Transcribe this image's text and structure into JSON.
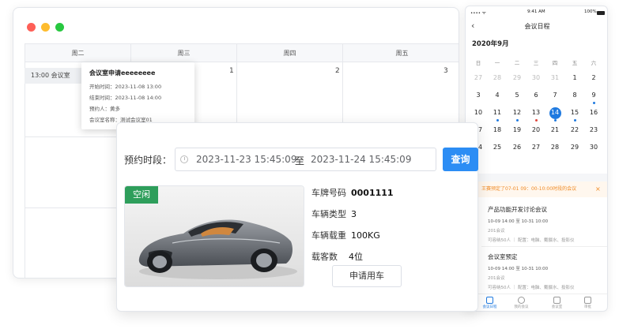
{
  "calendar": {
    "weekdays": [
      "周二",
      "周三",
      "周四",
      "周五"
    ],
    "day_numbers": [
      "1",
      "2",
      "3"
    ],
    "event_label": "13:00  会议室",
    "tooltip": {
      "title": "会议室申请eeeeeeee",
      "start": "开始时间：2023-11-08 13:00",
      "end": "结束时间：2023-11-08 14:00",
      "booker": "预约人：黄多",
      "room": "会议室名称：测试会议室01"
    },
    "window_dot_colors": [
      "#fe5f57",
      "#febc2e",
      "#28c840"
    ]
  },
  "phone": {
    "status_time": "9:41 AM",
    "battery": "100%",
    "back_icon": "chevron-left-icon",
    "title": "会议日程",
    "month": "2020年9月",
    "weekdays": [
      "日",
      "一",
      "二",
      "三",
      "四",
      "五",
      "六"
    ],
    "days": [
      [
        "27",
        "28",
        "29",
        "30",
        "31",
        "1",
        "2"
      ],
      [
        "3",
        "4",
        "5",
        "6",
        "7",
        "8",
        "9"
      ],
      [
        "10",
        "11",
        "12",
        "13",
        "14",
        "15",
        "16"
      ],
      [
        "17",
        "18",
        "19",
        "20",
        "21",
        "22",
        "23"
      ],
      [
        "24",
        "25",
        "26",
        "27",
        "28",
        "29",
        "30"
      ]
    ],
    "selected_day": "14",
    "notice": "王赛预定了07-01 09：00-10:00时段的会议",
    "notice_close": "×",
    "meetings": [
      {
        "title": "产品功能开发讨论会议",
        "time": "10-09  14:00 至 10-31 10:00",
        "room": "201会议",
        "meta": "可容纳50人 ｜ 配置：电脑、戴摄水、投影仪"
      },
      {
        "title": "会议室预定",
        "time": "10-09  14:00 至 10-31 10:00",
        "room": "201会议",
        "meta": "可容纳50人 ｜ 配置：电脑、戴摄水、投影仪"
      }
    ],
    "tabs": [
      "会议日程",
      "我的会议",
      "会议室",
      "审批"
    ],
    "accent_color": "#1f7ae0"
  },
  "booking": {
    "time_label": "预约时段：",
    "start": "2023-11-23 15:45:09",
    "separator": "至",
    "end": "2023-11-24 15:45:09",
    "query_button": "查询",
    "status_badge": "空闲",
    "plate_label": "车牌号码",
    "plate_value": "0001111",
    "type_label": "车辆类型",
    "type_value": "3",
    "load_label": "车辆载重",
    "load_value": "100KG",
    "seats_label": "载客数",
    "seats_value": "4位",
    "apply_button": "申请用车",
    "accent_color": "#2c8df4",
    "badge_color": "#2e9e5b"
  }
}
